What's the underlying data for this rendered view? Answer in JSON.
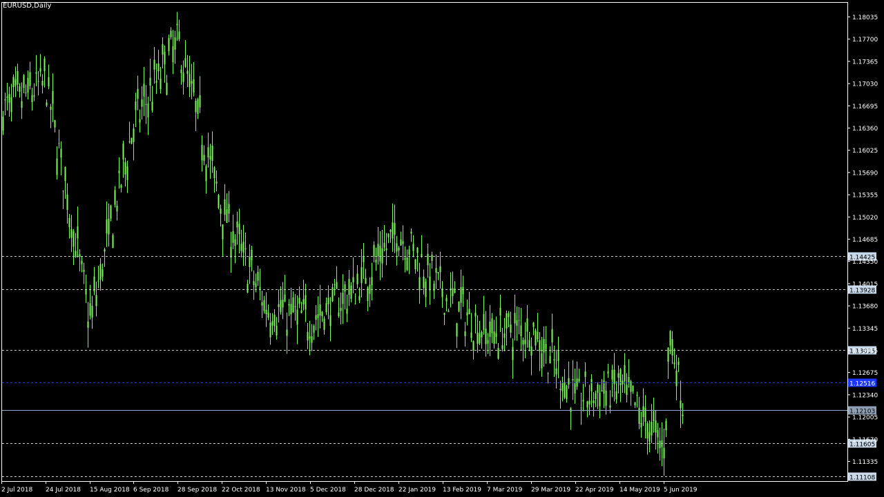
{
  "window": {
    "title": "EURUSD,Daily"
  },
  "colors": {
    "background": "#000000",
    "frame": "#ffffff",
    "candle": "#7CFC5A",
    "level_line": "#c8c8c8",
    "current_line": "#8ea8c8",
    "blue_line": "#1a36ff",
    "label_bg": "#c8d8e8",
    "label_text": "#000000"
  },
  "chart_data": {
    "type": "candlestick",
    "symbol": "EURUSD",
    "timeframe": "Daily",
    "y_ticks": [
      "1.18035",
      "1.17700",
      "1.17365",
      "1.17030",
      "1.16695",
      "1.16360",
      "1.16025",
      "1.15690",
      "1.15355",
      "1.15020",
      "1.14685",
      "1.14350",
      "1.14015",
      "1.13680",
      "1.13345",
      "1.13015",
      "1.12675",
      "1.12340",
      "1.12005",
      "1.11670",
      "1.11335"
    ],
    "x_ticks": [
      "2 Jul 2018",
      "24 Jul 2018",
      "15 Aug 2018",
      "6 Sep 2018",
      "28 Sep 2018",
      "22 Oct 2018",
      "13 Nov 2018",
      "5 Dec 2018",
      "28 Dec 2018",
      "22 Jan 2019",
      "13 Feb 2019",
      "7 Mar 2019",
      "29 Mar 2019",
      "22 Apr 2019",
      "14 May 2019",
      "5 Jun 2019"
    ],
    "ylim": [
      1.1103,
      1.1817
    ],
    "price_labels": [
      {
        "value": "1.14425",
        "style": "level"
      },
      {
        "value": "1.13928",
        "style": "level"
      },
      {
        "value": "1.13015",
        "style": "level"
      },
      {
        "value": "1.12516",
        "style": "blue"
      },
      {
        "value": "1.12103",
        "style": "current"
      },
      {
        "value": "1.11605",
        "style": "level"
      },
      {
        "value": "1.11108",
        "style": "level"
      }
    ],
    "close_path": [
      [
        "2 Jul 2018",
        1.166
      ],
      [
        "24 Jul 2018",
        1.1705
      ],
      [
        "15 Aug 2018",
        1.1345
      ],
      [
        "6 Sep 2018",
        1.164
      ],
      [
        "28 Sep 2018",
        1.1765
      ],
      [
        "22 Oct 2018",
        1.1515
      ],
      [
        "13 Nov 2018",
        1.1365
      ],
      [
        "5 Dec 2018",
        1.1345
      ],
      [
        "28 Dec 2018",
        1.1392
      ],
      [
        "22 Jan 2019",
        1.148
      ],
      [
        "13 Feb 2019",
        1.1385
      ],
      [
        "7 Mar 2019",
        1.1325
      ],
      [
        "29 Mar 2019",
        1.1335
      ],
      [
        "22 Apr 2019",
        1.1228
      ],
      [
        "14 May 2019",
        1.1245
      ],
      [
        "5 Jun 2019",
        1.1155
      ],
      [
        "12 Jun 2019",
        1.133
      ],
      [
        "end",
        1.12103
      ]
    ]
  }
}
